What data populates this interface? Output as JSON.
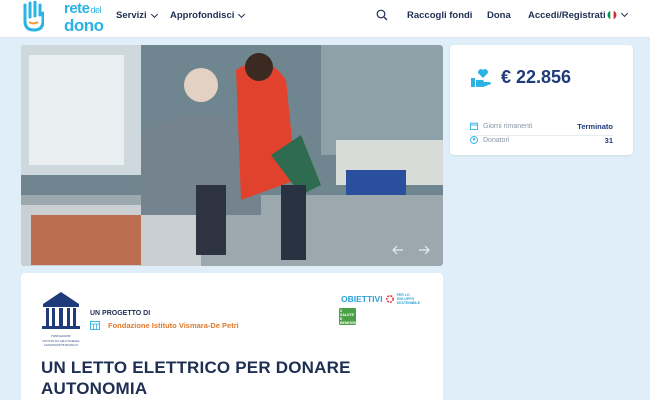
{
  "header": {
    "logo": {
      "line1": "rete",
      "line1_small": "del",
      "line2": "dono"
    },
    "nav": [
      {
        "label": "Servizi",
        "has_dropdown": true
      },
      {
        "label": "Approfondisci",
        "has_dropdown": true
      }
    ],
    "search_icon": "search-icon",
    "raise_funds_label": "Raccogli fondi",
    "donate_label": "Dona",
    "login_label": "Accedi/Registrati",
    "language_icon": "italy-flag-icon"
  },
  "hero": {
    "prev_icon": "arrow-left-icon",
    "next_icon": "arrow-right-icon"
  },
  "stats": {
    "amount": "€ 22.856",
    "amount_icon": "hand-heart-icon",
    "rows": [
      {
        "icon": "calendar-icon",
        "label": "Giorni rimanenti",
        "value": "Terminato"
      },
      {
        "icon": "donor-icon",
        "label": "Donatori",
        "value": "31"
      }
    ],
    "accent_color": "#1f3b7a"
  },
  "project": {
    "org_logo_lines": [
      "FONDAZIONE",
      "ISTITUTO DI CARLO VISMARA",
      "GIOVANNI DE PETRI ONLUS"
    ],
    "label": "UN PROGETTO DI",
    "org_name": "Fondazione Istituto Vismara-De Petri",
    "org_icon": "building-icon",
    "goals_title": "OBIETTIVI",
    "goals_sub": "PER LO SVILUPPO SOSTENIBILE",
    "sdg_badge": "3 SALUTE E BENESSERE",
    "title": "UN LETTO ELETTRICO PER DONARE AUTONOMIA",
    "org_color": "#e07a2e"
  }
}
